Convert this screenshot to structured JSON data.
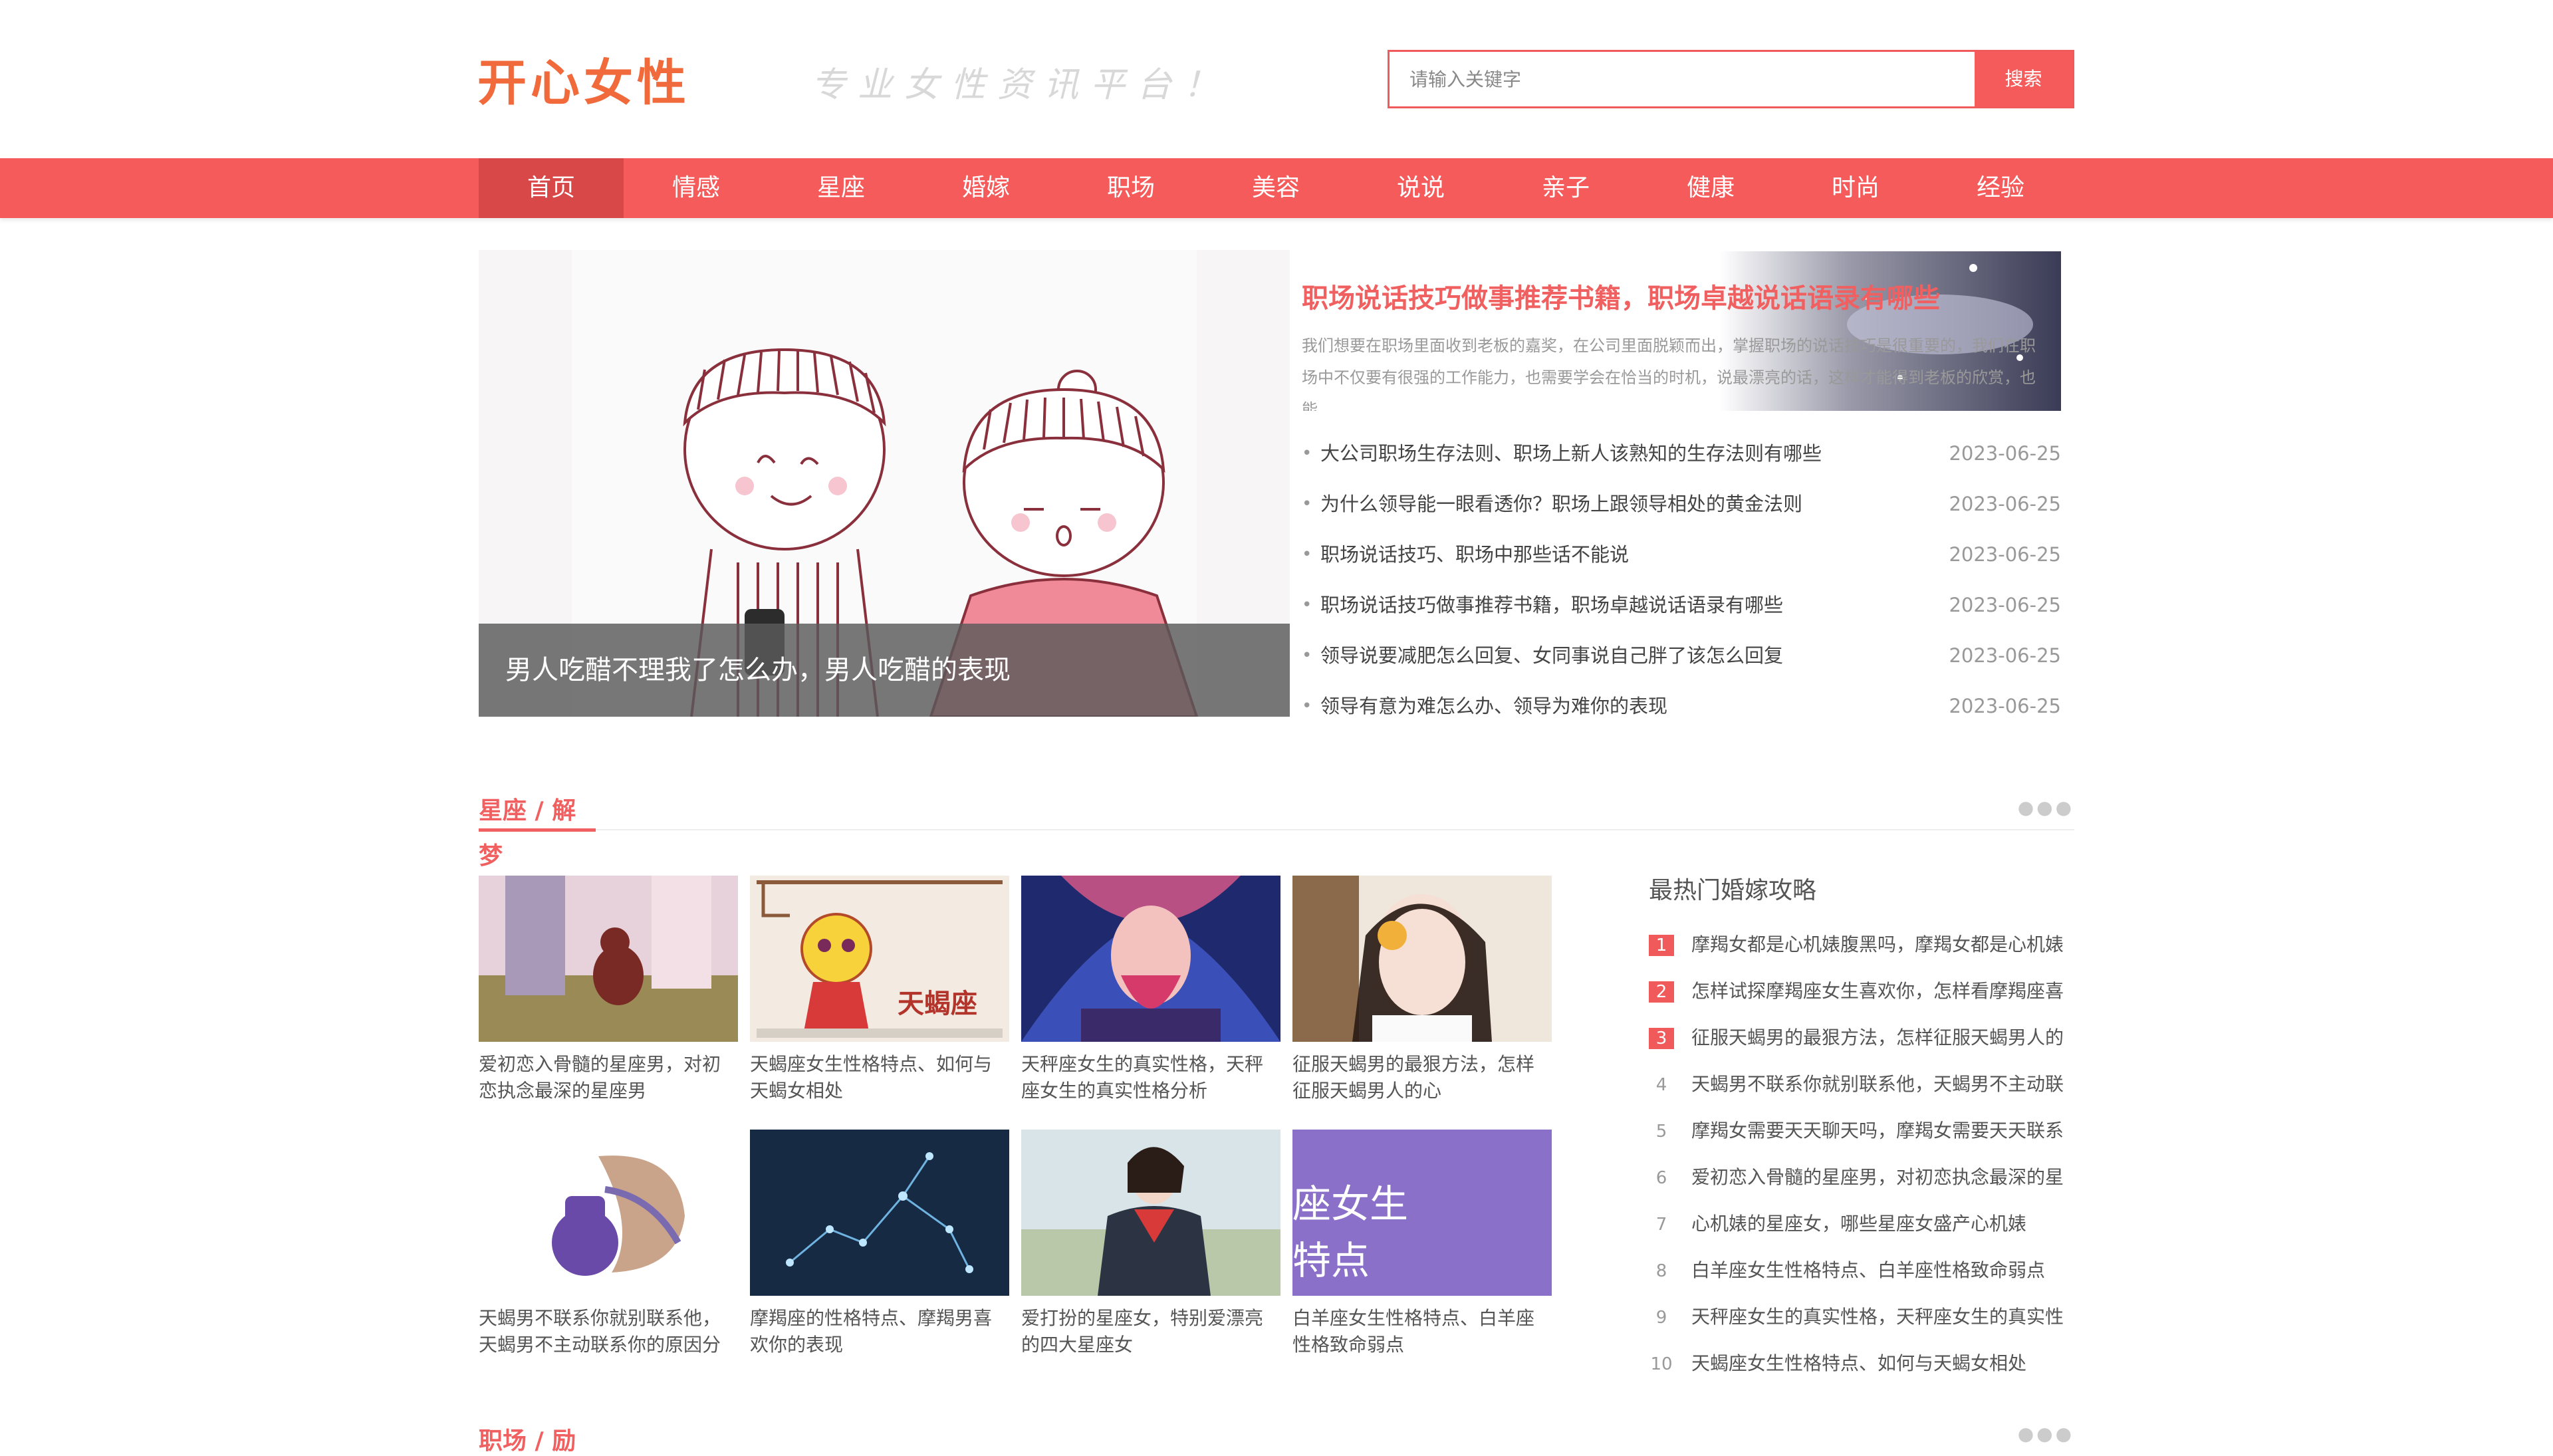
{
  "header": {
    "logo": "开心女性",
    "slogan": "专业女性资讯平台！",
    "search_placeholder": "请输入关键字",
    "search_button": "搜索"
  },
  "nav": [
    "首页",
    "情感",
    "星座",
    "婚嫁",
    "职场",
    "美容",
    "说说",
    "亲子",
    "健康",
    "时尚",
    "经验"
  ],
  "hero": {
    "caption": "男人吃醋不理我了怎么办，男人吃醋的表现"
  },
  "feature": {
    "title": "职场说话技巧做事推荐书籍，职场卓越说话语录有哪些",
    "desc": "我们想要在职场里面收到老板的嘉奖，在公司里面脱颖而出，掌握职场的说话技巧是很重要的，我们在职场中不仅要有很强的工作能力，也需要学会在恰当的时机，说最漂亮的话，这样才能得到老板的欣赏，也能"
  },
  "news": [
    {
      "title": "大公司职场生存法则、职场上新人该熟知的生存法则有哪些",
      "date": "2023-06-25"
    },
    {
      "title": "为什么领导能一眼看透你？职场上跟领导相处的黄金法则",
      "date": "2023-06-25"
    },
    {
      "title": "职场说话技巧、职场中那些话不能说",
      "date": "2023-06-25"
    },
    {
      "title": "职场说话技巧做事推荐书籍，职场卓越说话语录有哪些",
      "date": "2023-06-25"
    },
    {
      "title": "领导说要减肥怎么回复、女同事说自己胖了该怎么回复",
      "date": "2023-06-25"
    },
    {
      "title": "领导有意为难怎么办、领导为难你的表现",
      "date": "2023-06-25"
    }
  ],
  "section": {
    "title": "星座 / 解梦",
    "dots": "●●●"
  },
  "cards": [
    {
      "text": "爱初恋入骨髓的星座男，对初恋执念最深的星座男",
      "img": "couple"
    },
    {
      "text": "天蝎座女生性格特点、如何与天蝎女相处",
      "img": "scorpio"
    },
    {
      "text": "天秤座女生的真实性格，天秤座女生的真实性格分析",
      "img": "libra"
    },
    {
      "text": "征服天蝎男的最狠方法，怎样征服天蝎男人的心",
      "img": "girl"
    },
    {
      "text": "天蝎男不联系你就别联系他，天蝎男不主动联系你的原因分",
      "img": "pot"
    },
    {
      "text": "摩羯座的性格特点、摩羯男喜欢你的表现",
      "img": "constellation"
    },
    {
      "text": "爱打扮的星座女，特别爱漂亮的四大星座女",
      "img": "uniform"
    },
    {
      "text": "白羊座女生性格特点、白羊座性格致命弱点",
      "img": "purple"
    }
  ],
  "purple_card_text": [
    "座女生",
    "特点"
  ],
  "scorpio_label": "天蝎座",
  "hot": {
    "title": "最热门婚嫁攻略",
    "items": [
      {
        "num": "1",
        "text": "摩羯女都是心机婊腹黑吗，摩羯女都是心机婊"
      },
      {
        "num": "2",
        "text": "怎样试探摩羯座女生喜欢你，怎样看摩羯座喜"
      },
      {
        "num": "3",
        "text": "征服天蝎男的最狠方法，怎样征服天蝎男人的"
      },
      {
        "num": "4",
        "text": "天蝎男不联系你就别联系他，天蝎男不主动联"
      },
      {
        "num": "5",
        "text": "摩羯女需要天天聊天吗，摩羯女需要天天联系"
      },
      {
        "num": "6",
        "text": "爱初恋入骨髓的星座男，对初恋执念最深的星"
      },
      {
        "num": "7",
        "text": "心机婊的星座女，哪些星座女盛产心机婊"
      },
      {
        "num": "8",
        "text": "白羊座女生性格特点、白羊座性格致命弱点"
      },
      {
        "num": "9",
        "text": "天秤座女生的真实性格，天秤座女生的真实性"
      },
      {
        "num": "10",
        "text": "天蝎座女生性格特点、如何与天蝎女相处"
      }
    ]
  },
  "next_section": {
    "title": "职场 / 励"
  },
  "colors": {
    "accent": "#f55b5b",
    "title_red": "#f06060"
  }
}
